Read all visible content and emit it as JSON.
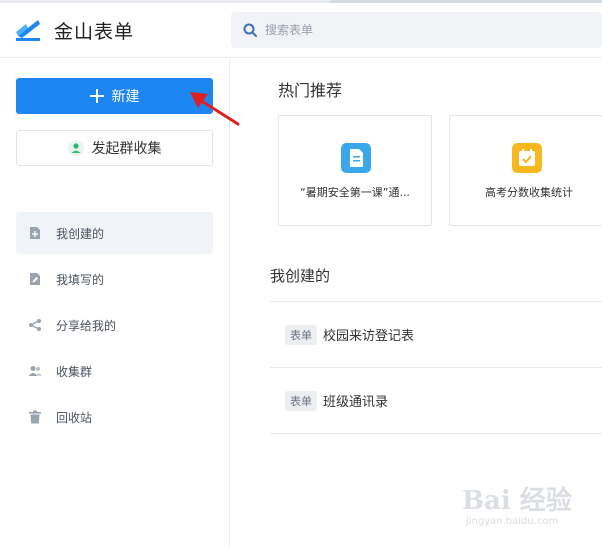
{
  "app": {
    "brand": "金山表单"
  },
  "search": {
    "placeholder": "搜索表单"
  },
  "sidebar": {
    "new_button": "新建",
    "collect_button": "发起群收集",
    "items": [
      {
        "label": "我创建的",
        "icon": "form-add-icon",
        "active": true
      },
      {
        "label": "我填写的",
        "icon": "edit-form-icon",
        "active": false
      },
      {
        "label": "分享给我的",
        "icon": "share-icon",
        "active": false
      },
      {
        "label": "收集群",
        "icon": "group-icon",
        "active": false
      },
      {
        "label": "回收站",
        "icon": "trash-icon",
        "active": false
      }
    ]
  },
  "hot": {
    "title": "热门推荐",
    "cards": [
      {
        "title": "“暑期安全第一课”通...",
        "icon": "document-icon",
        "color": "#3aa6ec"
      },
      {
        "title": "高考分数收集统计",
        "icon": "calendar-check-icon",
        "color": "#f6b81e"
      }
    ]
  },
  "mine": {
    "title": "我创建的",
    "rows": [
      {
        "tag": "表单",
        "name": "校园来访登记表"
      },
      {
        "tag": "表单",
        "name": "班级通讯录"
      }
    ]
  },
  "colors": {
    "primary": "#1d86f0",
    "annotation": "#e02020"
  },
  "watermark": {
    "text": "Bai 经验",
    "sub": "jingyan.baidu.com"
  }
}
